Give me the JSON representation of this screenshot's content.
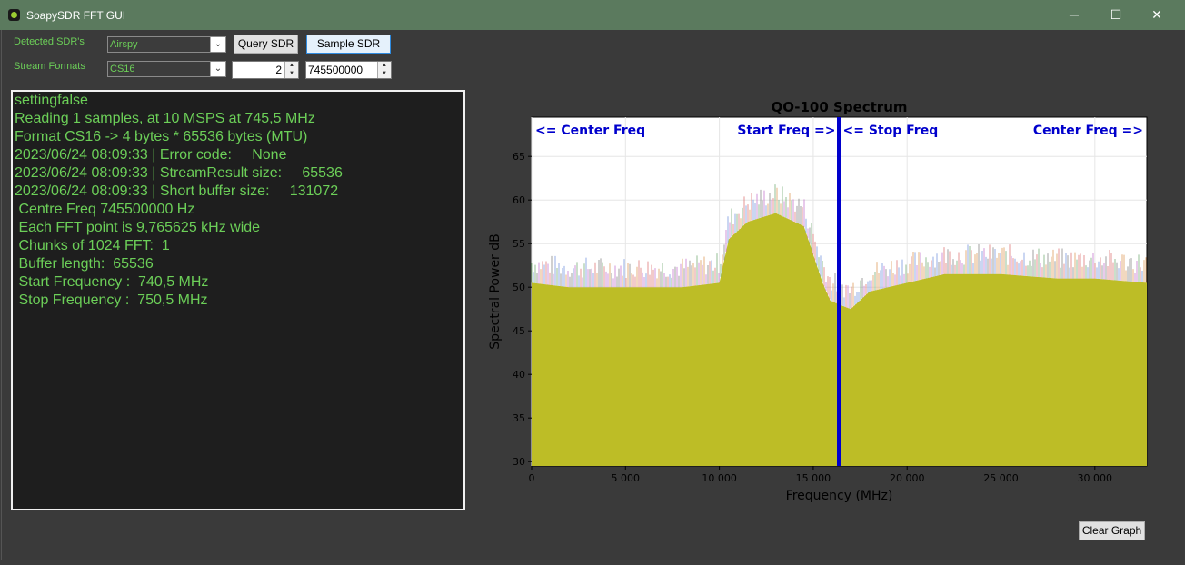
{
  "window": {
    "title": "SoapySDR FFT GUI",
    "controls": [
      "─",
      "☐",
      "✕"
    ]
  },
  "toolbar": {
    "detected_label": "Detected SDR's",
    "detected_value": "Airspy",
    "query_button": "Query SDR",
    "sample_button": "Sample SDR",
    "stream_label": "Stream Formats",
    "stream_value": "CS16",
    "samples_value": "2",
    "freq_value": "745500000"
  },
  "console": {
    "lines": [
      "settingfalse",
      "Reading 1 samples, at 10 MSPS at 745,5 MHz",
      "Format CS16 -> 4 bytes * 65536 bytes (MTU)",
      "2023/06/24 08:09:33 | Error code:     None",
      "2023/06/24 08:09:33 | StreamResult size:     65536",
      "2023/06/24 08:09:33 | Short buffer size:     131072",
      " Centre Freq 745500000 Hz",
      " Each FFT point is 9,765625 kHz wide",
      " Chunks of 1024 FFT:  1",
      " Buffer length:  65536",
      " Start Frequency :  740,5 MHz",
      " Stop Frequency :  750,5 MHz"
    ]
  },
  "chart_data": {
    "type": "area",
    "title": "QO-100 Spectrum",
    "xlabel": "Frequency (MHz)",
    "ylabel": "Spectral Power dB",
    "xlim": [
      0,
      32768
    ],
    "ylim": [
      29.5,
      69.5
    ],
    "xticks": [
      0,
      5000,
      10000,
      15000,
      20000,
      25000,
      30000
    ],
    "xtick_labels": [
      "0",
      "5 000",
      "10 000",
      "15 000",
      "20 000",
      "25 000",
      "30 000"
    ],
    "yticks": [
      30,
      35,
      40,
      45,
      50,
      55,
      60,
      65
    ],
    "grid": true,
    "fill_color": "#bdbd26",
    "marker_color": "#0000cc",
    "marker_x": 16384,
    "annotations": [
      {
        "text": "<= Center Freq",
        "anchor": "start",
        "x": 0
      },
      {
        "text": "Start Freq =>",
        "anchor": "end",
        "x": 16384
      },
      {
        "text": "<= Stop Freq",
        "anchor": "start",
        "x": 16384
      },
      {
        "text": "Center Freq =>",
        "anchor": "end",
        "x": 32768
      }
    ],
    "series": [
      {
        "x": [
          0,
          2000,
          5000,
          8000,
          10000,
          10500,
          11500,
          13000,
          14500,
          15500,
          15900,
          16384,
          17000,
          18000,
          20000,
          22000,
          25000,
          28000,
          30000,
          32768
        ],
        "values": [
          50.5,
          50,
          50,
          50,
          50.5,
          55.5,
          57.5,
          58.5,
          57,
          50.5,
          48.5,
          48,
          47.5,
          49.5,
          50.5,
          51.5,
          51.5,
          51,
          51,
          50.5
        ]
      }
    ]
  },
  "buttons": {
    "clear_graph": "Clear Graph"
  }
}
